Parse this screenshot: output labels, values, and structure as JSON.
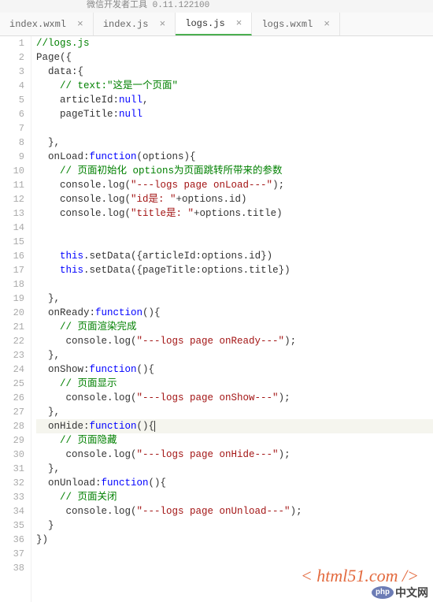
{
  "titleBar": "微信开发者工具 0.11.122100",
  "tabs": [
    {
      "label": "index.wxml",
      "active": false
    },
    {
      "label": "index.js",
      "active": false
    },
    {
      "label": "logs.js",
      "active": true
    },
    {
      "label": "logs.wxml",
      "active": false
    }
  ],
  "code": {
    "lines": [
      [
        {
          "t": "//logs.js",
          "c": "c-comment"
        }
      ],
      [
        {
          "t": "Page({",
          "c": ""
        }
      ],
      [
        {
          "t": "  data:{",
          "c": ""
        }
      ],
      [
        {
          "t": "    ",
          "c": ""
        },
        {
          "t": "// text:\"这是一个页面\"",
          "c": "c-comment"
        }
      ],
      [
        {
          "t": "    articleId:",
          "c": ""
        },
        {
          "t": "null",
          "c": "c-keyword"
        },
        {
          "t": ",",
          "c": ""
        }
      ],
      [
        {
          "t": "    pageTitle:",
          "c": ""
        },
        {
          "t": "null",
          "c": "c-keyword"
        }
      ],
      [
        {
          "t": "",
          "c": ""
        }
      ],
      [
        {
          "t": "  },",
          "c": ""
        }
      ],
      [
        {
          "t": "  onLoad:",
          "c": ""
        },
        {
          "t": "function",
          "c": "c-keyword"
        },
        {
          "t": "(options){",
          "c": ""
        }
      ],
      [
        {
          "t": "    ",
          "c": ""
        },
        {
          "t": "// 页面初始化 options为页面跳转所带来的参数",
          "c": "c-comment"
        }
      ],
      [
        {
          "t": "    console.log(",
          "c": ""
        },
        {
          "t": "\"---logs page onLoad---\"",
          "c": "c-string"
        },
        {
          "t": ");",
          "c": ""
        }
      ],
      [
        {
          "t": "    console.log(",
          "c": ""
        },
        {
          "t": "\"id是: \"",
          "c": "c-string"
        },
        {
          "t": "+options.id)",
          "c": ""
        }
      ],
      [
        {
          "t": "    console.log(",
          "c": ""
        },
        {
          "t": "\"title是: \"",
          "c": "c-string"
        },
        {
          "t": "+options.title)",
          "c": ""
        }
      ],
      [
        {
          "t": "",
          "c": ""
        }
      ],
      [
        {
          "t": "",
          "c": ""
        }
      ],
      [
        {
          "t": "    ",
          "c": ""
        },
        {
          "t": "this",
          "c": "c-keyword"
        },
        {
          "t": ".setData({articleId:options.id})",
          "c": ""
        }
      ],
      [
        {
          "t": "    ",
          "c": ""
        },
        {
          "t": "this",
          "c": "c-keyword"
        },
        {
          "t": ".setData({pageTitle:options.title})",
          "c": ""
        }
      ],
      [
        {
          "t": "",
          "c": ""
        }
      ],
      [
        {
          "t": "  },",
          "c": ""
        }
      ],
      [
        {
          "t": "  onReady:",
          "c": ""
        },
        {
          "t": "function",
          "c": "c-keyword"
        },
        {
          "t": "(){",
          "c": ""
        }
      ],
      [
        {
          "t": "    ",
          "c": ""
        },
        {
          "t": "// 页面渲染完成",
          "c": "c-comment"
        }
      ],
      [
        {
          "t": "     console.log(",
          "c": ""
        },
        {
          "t": "\"---logs page onReady---\"",
          "c": "c-string"
        },
        {
          "t": ");",
          "c": ""
        }
      ],
      [
        {
          "t": "  },",
          "c": ""
        }
      ],
      [
        {
          "t": "  onShow:",
          "c": ""
        },
        {
          "t": "function",
          "c": "c-keyword"
        },
        {
          "t": "(){",
          "c": ""
        }
      ],
      [
        {
          "t": "    ",
          "c": ""
        },
        {
          "t": "// 页面显示",
          "c": "c-comment"
        }
      ],
      [
        {
          "t": "     console.log(",
          "c": ""
        },
        {
          "t": "\"---logs page onShow---\"",
          "c": "c-string"
        },
        {
          "t": ");",
          "c": ""
        }
      ],
      [
        {
          "t": "  },",
          "c": ""
        }
      ],
      [
        {
          "t": "  onHide:",
          "c": ""
        },
        {
          "t": "function",
          "c": "c-keyword"
        },
        {
          "t": "(){",
          "c": ""
        }
      ],
      [
        {
          "t": "    ",
          "c": ""
        },
        {
          "t": "// 页面隐藏",
          "c": "c-comment"
        }
      ],
      [
        {
          "t": "     console.log(",
          "c": ""
        },
        {
          "t": "\"---logs page onHide---\"",
          "c": "c-string"
        },
        {
          "t": ");",
          "c": ""
        }
      ],
      [
        {
          "t": "  },",
          "c": ""
        }
      ],
      [
        {
          "t": "  onUnload:",
          "c": ""
        },
        {
          "t": "function",
          "c": "c-keyword"
        },
        {
          "t": "(){",
          "c": ""
        }
      ],
      [
        {
          "t": "    ",
          "c": ""
        },
        {
          "t": "// 页面关闭",
          "c": "c-comment"
        }
      ],
      [
        {
          "t": "     console.log(",
          "c": ""
        },
        {
          "t": "\"---logs page onUnload---\"",
          "c": "c-string"
        },
        {
          "t": ");",
          "c": ""
        }
      ],
      [
        {
          "t": "  }",
          "c": ""
        }
      ],
      [
        {
          "t": "})",
          "c": ""
        }
      ],
      [
        {
          "t": "",
          "c": ""
        }
      ],
      [
        {
          "t": "",
          "c": ""
        }
      ]
    ],
    "highlightLine": 28,
    "cursorAfter": "(){"
  },
  "watermark1": "< html51.com />",
  "watermark2": {
    "badge": "php",
    "text": "中文网"
  }
}
